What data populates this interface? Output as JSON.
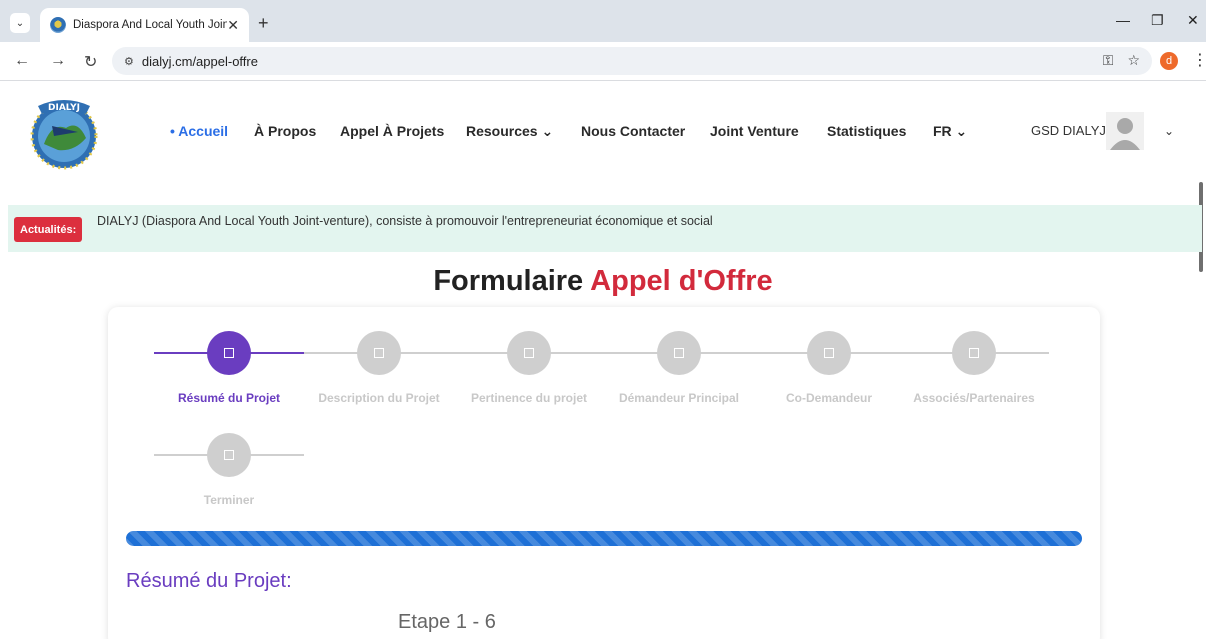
{
  "browser": {
    "tab_title": "Diaspora And Local Youth Joint-venture",
    "url": "dialyj.cm/appel-offre",
    "profile_initial": "d",
    "icons": [
      "tab-dropdown-icon",
      "close-icon",
      "plus-icon",
      "minimize-icon",
      "restore-icon",
      "back-icon",
      "forward-icon",
      "reload-icon",
      "site-info-icon",
      "key-icon",
      "star-icon",
      "kebab-icon"
    ]
  },
  "site": {
    "nav": [
      {
        "label": "• Accueil",
        "active": true
      },
      {
        "label": "À Propos"
      },
      {
        "label": "Appel À Projets"
      },
      {
        "label": "Resources ⌄"
      },
      {
        "label": "Nous Contacter"
      },
      {
        "label": "Joint Venture"
      },
      {
        "label": "Statistiques"
      },
      {
        "label": "FR ⌄"
      }
    ],
    "user_name": "GSD DIALYJ"
  },
  "ticker": {
    "badge": "Actualités:",
    "text": "DIALYJ (Diaspora And Local Youth Joint-venture), consiste à promouvoir l'entrepreneuriat économique et social"
  },
  "page": {
    "title_main": "Formulaire",
    "title_accent": "Appel d'Offre"
  },
  "steps": [
    {
      "label": "Résumé du Projet",
      "active": true
    },
    {
      "label": "Description du Projet",
      "active": false
    },
    {
      "label": "Pertinence du projet",
      "active": false
    },
    {
      "label": "Démandeur Principal",
      "active": false
    },
    {
      "label": "Co-Demandeur",
      "active": false
    },
    {
      "label": "Associés/Partenaires",
      "active": false
    },
    {
      "label": "Terminer",
      "active": false
    }
  ],
  "progress": {
    "value": 1.0
  },
  "section": {
    "title": "Résumé du Projet:",
    "step_count": "Etape 1 - 6"
  },
  "colors": {
    "accent_purple": "#6a3dc0",
    "title_red": "#d22a3c",
    "nav_active": "#2b6ee6",
    "progress_blue": "#1e70d6",
    "ticker_bg": "#e3f5ef",
    "badge_red": "#dc2f3e"
  }
}
